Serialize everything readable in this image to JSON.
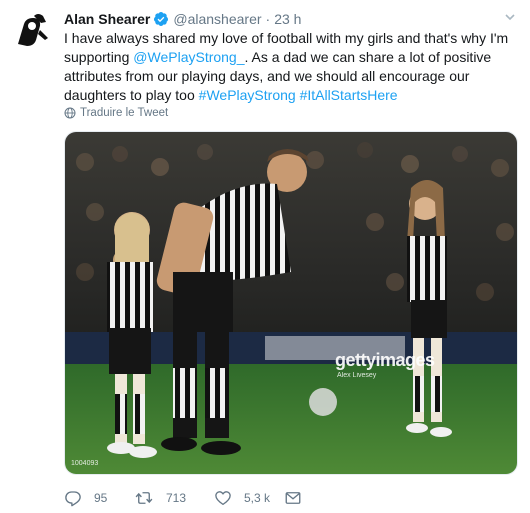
{
  "tweet": {
    "display_name": "Alan Shearer",
    "handle": "@alanshearer",
    "separator": "·",
    "time": "23 h",
    "text_part1": "I have always shared my love of football with my girls and that's why I'm supporting ",
    "mention": "@WePlayStrong_",
    "text_part2": ". As a dad we can share a lot of positive attributes from our playing days, and we should all encourage our daughters to play too ",
    "hashtag1": "#WePlayStrong",
    "hashtag_space": " ",
    "hashtag2": "#ItAllStartsHere",
    "translate_label": "Traduire le Tweet"
  },
  "media": {
    "watermark": "gettyimages",
    "watermark_credit": "Alex Livesey",
    "photo_id": "1004093"
  },
  "actions": {
    "reply_count": "95",
    "retweet_count": "713",
    "like_count": "5,3 k"
  },
  "icons": {
    "avatar": "alan-shearer-9-logo",
    "verified": "verified-badge-icon",
    "caret": "chevron-down-icon",
    "translate": "globe-icon",
    "reply": "reply-icon",
    "retweet": "retweet-icon",
    "like": "heart-icon",
    "dm": "envelope-icon"
  },
  "colors": {
    "accent": "#1da1f2",
    "text": "#14171a",
    "muted": "#657786"
  }
}
